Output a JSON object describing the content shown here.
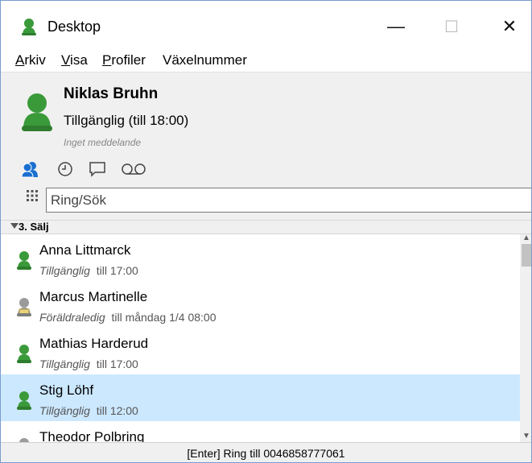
{
  "window": {
    "title": "Desktop",
    "minimize_glyph": "—",
    "maximize_glyph": "☐",
    "close_glyph": "✕"
  },
  "menu": {
    "items": [
      {
        "accel": "A",
        "rest": "rkiv"
      },
      {
        "accel": "V",
        "rest": "isa"
      },
      {
        "accel": "P",
        "rest": "rofiler"
      },
      {
        "accel": "",
        "rest": "Växelnummer"
      }
    ]
  },
  "profile": {
    "name": "Niklas Bruhn",
    "status": "Tillgänglig (till 18:00)",
    "message": "Inget meddelande",
    "tools": [
      "presence-icon",
      "clock-icon",
      "chat-icon",
      "voicemail-icon"
    ]
  },
  "search": {
    "placeholder": "Ring/Sök",
    "value": ""
  },
  "group": {
    "label": "3. Sälj"
  },
  "contacts": [
    {
      "name": "Anna Littmarck",
      "state": "Tillgänglig",
      "until": "till 17:00",
      "presence": "available"
    },
    {
      "name": "Marcus Martinelle",
      "state": "Föräldraledig",
      "until": "till måndag 1/4 08:00",
      "presence": "away"
    },
    {
      "name": "Mathias Harderud",
      "state": "Tillgänglig",
      "until": "till 17:00",
      "presence": "available"
    },
    {
      "name": "Stig Löhf",
      "state": "Tillgänglig",
      "until": "till 12:00",
      "presence": "available",
      "selected": true
    },
    {
      "name": "Theodor Polbring",
      "state": "",
      "until": "",
      "presence": "away"
    }
  ],
  "statusbar": {
    "text": "[Enter] Ring till 0046858777061"
  },
  "colors": {
    "available": "#3a9a3a",
    "away": "#9a9a9a",
    "presence_blue": "#1a6fd0",
    "selected_bg": "#cce8ff"
  }
}
